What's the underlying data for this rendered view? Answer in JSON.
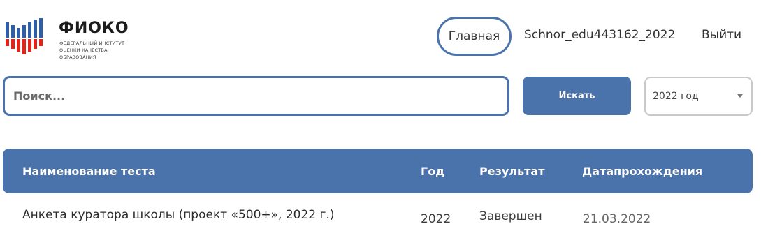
{
  "header": {
    "logo": {
      "title": "ФИОКО",
      "subtitle_line1": "ФЕДЕРАЛЬНЫЙ ИНСТИТУТ",
      "subtitle_line2": "ОЦЕНКИ КАЧЕСТВА ОБРАЗОВАНИЯ",
      "colors": {
        "blue": "#2f5fa8",
        "red": "#e2231a"
      }
    },
    "nav": {
      "home": "Главная",
      "user": "Schnor_edu443162_2022",
      "exit": "Выйти"
    }
  },
  "search": {
    "placeholder": "Поиск...",
    "value": "",
    "button_label": "Искать",
    "year_select": {
      "selected": "2022 год"
    }
  },
  "table": {
    "columns": [
      "Наименование теста",
      "Год",
      "Результат",
      "Датапрохождения"
    ],
    "rows": [
      {
        "name": "Анкета куратора школы (проект «500+», 2022 г.)",
        "year": "2022",
        "result": "Завершен",
        "date": "21.03.2022"
      }
    ]
  },
  "theme": {
    "accent": "#4a72ab",
    "border_gray": "#c9c9c9"
  }
}
